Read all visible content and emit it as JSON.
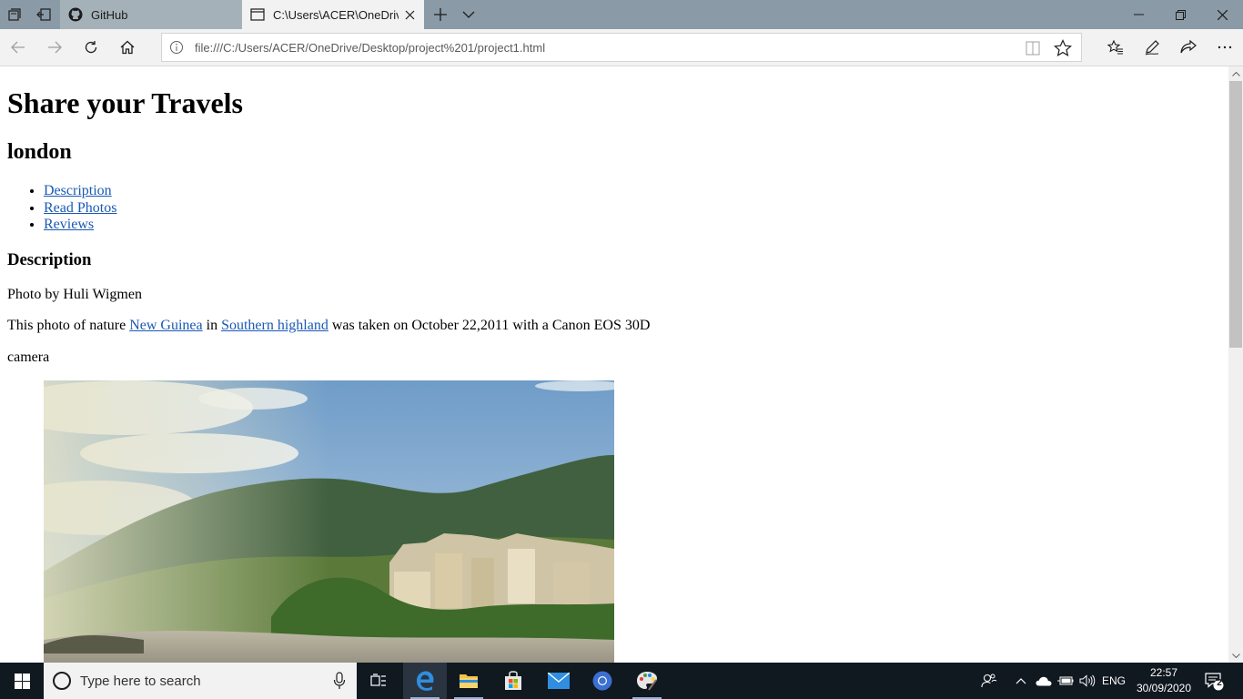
{
  "browser": {
    "tabs": [
      {
        "title": "GitHub",
        "active": false
      },
      {
        "title": "C:\\Users\\ACER\\OneDriv",
        "active": true
      }
    ],
    "address": "file:///C:/Users/ACER/OneDrive/Desktop/project%201/project1.html"
  },
  "page": {
    "heading": "Share your Travels",
    "subheading": "london",
    "nav_links": [
      "Description",
      "Read Photos",
      "Reviews"
    ],
    "section_title": "Description",
    "photo_credit": "Photo by Huli Wigmen",
    "desc_prefix": "This photo of nature ",
    "link_place": "New Guinea",
    "desc_mid": " in ",
    "link_region": "Southern highland",
    "desc_suffix": " was taken on October 22,2011 with a Canon EOS 30D",
    "desc_last": "camera"
  },
  "taskbar": {
    "search_placeholder": "Type here to search",
    "language": "ENG",
    "time": "22:57",
    "date": "30/09/2020",
    "notification_count": "2"
  },
  "colors": {
    "tabbar": "#8a9aa6",
    "link": "#1a59b4",
    "taskbar": "#101820"
  }
}
